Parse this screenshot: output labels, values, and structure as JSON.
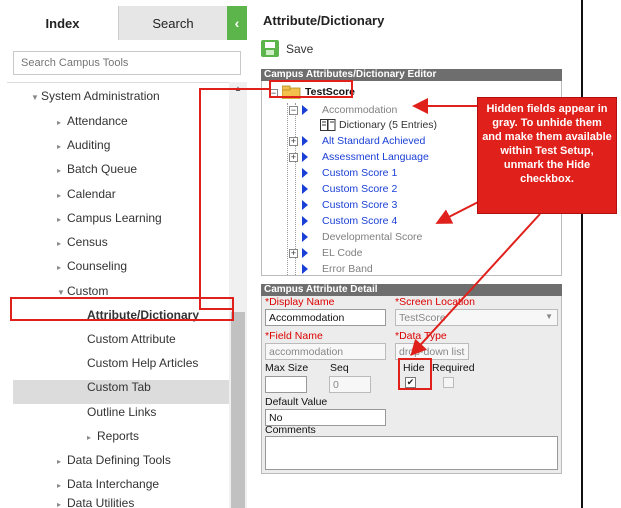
{
  "left_panel": {
    "tabs": {
      "index": "Index",
      "search": "Search"
    },
    "collapse_glyph": "‹",
    "search_placeholder": "Search Campus Tools",
    "tree": {
      "system_admin": "System Administration",
      "attendance": "Attendance",
      "auditing": "Auditing",
      "batch_queue": "Batch Queue",
      "calendar": "Calendar",
      "campus_learning": "Campus Learning",
      "census": "Census",
      "counseling": "Counseling",
      "custom": "Custom",
      "attribute_dictionary": "Attribute/Dictionary",
      "custom_attribute": "Custom Attribute",
      "custom_help_articles": "Custom Help Articles",
      "custom_tab": "Custom Tab",
      "outline_links": "Outline Links",
      "reports": "Reports",
      "data_defining_tools": "Data Defining Tools",
      "data_interchange": "Data Interchange",
      "data_utilities": "Data Utilities"
    }
  },
  "right_panel": {
    "title": "Attribute/Dictionary",
    "save_label": "Save",
    "editor": {
      "header": "Campus Attributes/Dictionary Editor",
      "root": "TestScore",
      "accommodation": "Accommodation",
      "dictionary": "Dictionary (5 Entries)",
      "alt_standard": "Alt Standard Achieved",
      "assessment_language": "Assessment Language",
      "custom_score_1": "Custom Score 1",
      "custom_score_2": "Custom Score 2",
      "custom_score_3": "Custom Score 3",
      "custom_score_4": "Custom Score 4",
      "developmental_score": "Developmental Score",
      "el_code": "EL Code",
      "error_band": "Error Band"
    },
    "detail": {
      "header": "Campus Attribute Detail",
      "display_name_label": "Display Name",
      "display_name_value": "Accommodation",
      "screen_location_label": "Screen Location",
      "screen_location_value": "TestScore",
      "field_name_label": "Field Name",
      "field_name_value": "accommodation",
      "data_type_label": "Data Type",
      "data_type_value": "drop-down list",
      "max_size_label": "Max Size",
      "max_size_value": "",
      "seq_label": "Seq",
      "seq_value": "0",
      "hide_label": "Hide",
      "required_label": "Required",
      "default_value_label": "Default Value",
      "default_value_value": "No",
      "comments_label": "Comments",
      "required_marker": "*"
    }
  },
  "annotation": {
    "callout_text": "Hidden fields appear in gray. To unhide them and make them available within Test Setup, unmark the Hide checkbox.",
    "color": "#e0201b"
  },
  "colors": {
    "brand_green": "#5cb54a",
    "link_blue": "#1a3fd6",
    "hidden_gray": "#808080",
    "header_gray": "#6e6e6e"
  }
}
